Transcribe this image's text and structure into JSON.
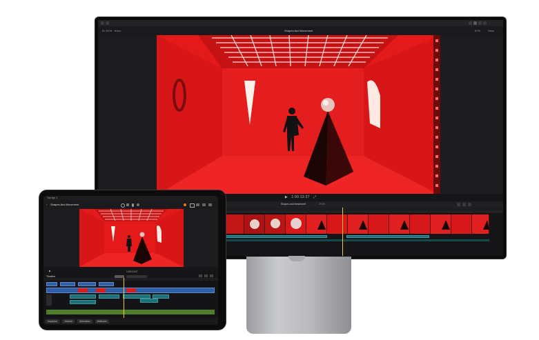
{
  "monitor": {
    "top_bar": {
      "left_text": "ID 4578 · Ienes",
      "right_text": "67%",
      "view_label": "View"
    },
    "viewer_title": "Shapes And Movement",
    "timecode": "1:00:13:27",
    "timeline_project": "Shapes and Movement",
    "timeline_duration": "29:09"
  },
  "ipad": {
    "status": "Tue Apr 1",
    "project_title": "Shapes And Movement",
    "timecode": "1:00:13:27",
    "timeline_label": "Timeline",
    "bottom_tabs": [
      "Inspector",
      "Volume",
      "Animation",
      "Multicam"
    ]
  },
  "colors": {
    "viewer_red": "#e3191a",
    "clip_blue": "#2f5fa8",
    "clip_teal": "#1d6e76",
    "playhead": "#f0c830"
  },
  "icons": [
    "back-icon",
    "share-icon",
    "camera-icon",
    "mic-icon",
    "play-icon",
    "gear-icon"
  ]
}
